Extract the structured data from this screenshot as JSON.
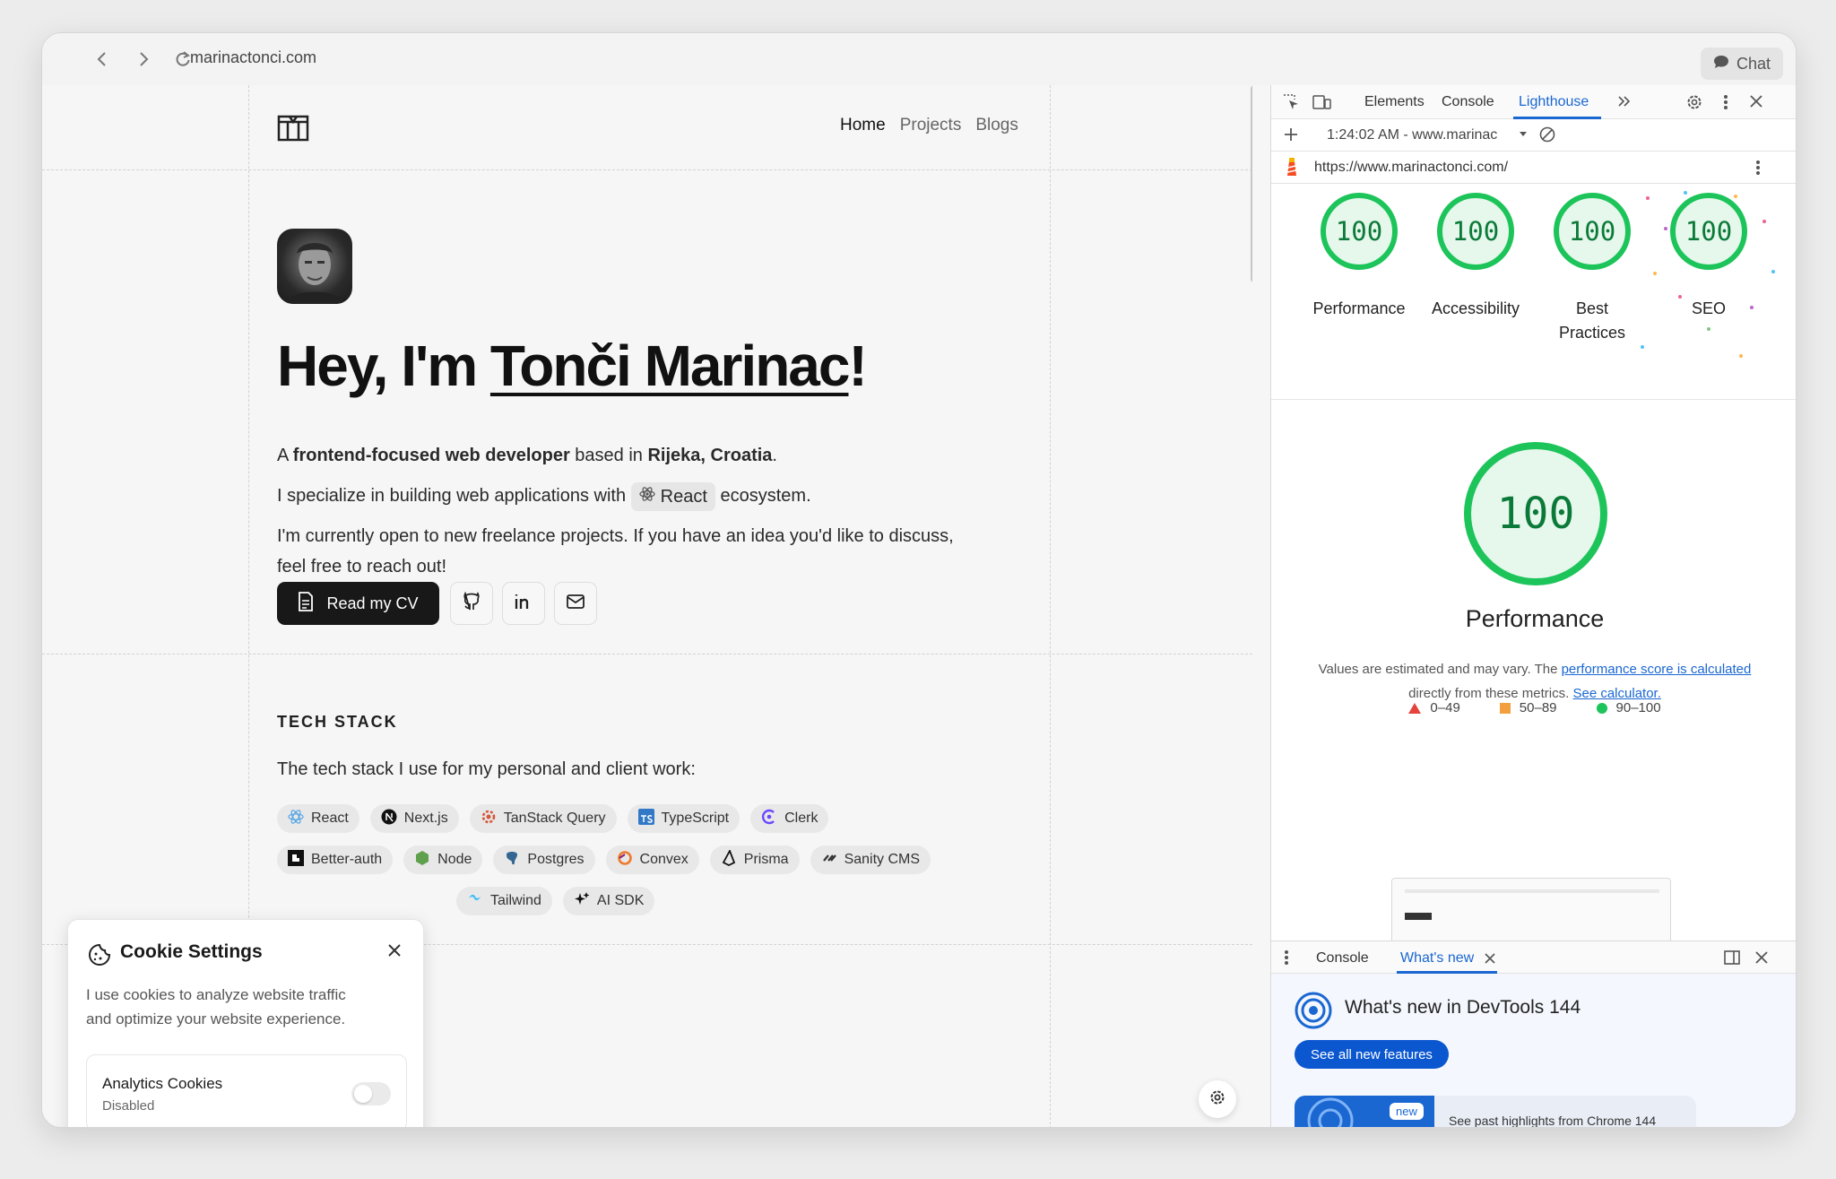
{
  "browser": {
    "url": "marinactonci.com",
    "chat_label": "Chat"
  },
  "site": {
    "nav": [
      "Home",
      "Projects",
      "Blogs"
    ],
    "hero": {
      "greeting": "Hey, I'm ",
      "name": "Tonči Marinac",
      "exclaim": "!"
    },
    "intro": {
      "a": "A ",
      "role": "frontend-focused web developer",
      "based": " based in ",
      "city": "Rijeka, Croatia",
      "dot": "."
    },
    "special": {
      "before": "I specialize in building web applications with ",
      "chip": "React",
      "after": " ecosystem."
    },
    "freelance_1": "I'm currently open to new freelance projects. If you have an idea you'd like to discuss,",
    "freelance_2": "feel free to reach out!",
    "cv_label": "Read my CV",
    "tech_title": "TECH STACK",
    "tech_intro": "The tech stack I use for my personal and client work:",
    "tech_row1": [
      "React",
      "Next.js",
      "TanStack Query",
      "TypeScript",
      "Clerk"
    ],
    "tech_row2": [
      "Better-auth",
      "Node",
      "Postgres",
      "Convex",
      "Prisma",
      "Sanity CMS"
    ],
    "tech_row3": [
      "Tailwind",
      "AI SDK"
    ]
  },
  "cookie": {
    "title": "Cookie Settings",
    "text_1": "I use cookies to analyze website traffic",
    "text_2": "and optimize your website experience.",
    "analytics_label": "Analytics Cookies",
    "analytics_state": "Disabled"
  },
  "devtools": {
    "tabs": [
      "Elements",
      "Console",
      "Lighthouse"
    ],
    "report": "1:24:02 AM - www.marinac",
    "report_url": "https://www.marinactonci.com/",
    "scores": [
      {
        "value": "100",
        "label": "Performance"
      },
      {
        "value": "100",
        "label": "Accessibility"
      },
      {
        "value": "100",
        "label": "Best Practices"
      },
      {
        "value": "100",
        "label": "SEO"
      }
    ],
    "main_score": "100",
    "main_title": "Performance",
    "note_pre": "Values are estimated and may vary. The ",
    "note_link1": "performance score is calculated",
    "note_mid": " directly from these metrics. ",
    "note_link2": "See calculator.",
    "legend": [
      "0–49",
      "50–89",
      "90–100"
    ],
    "drawer_tabs": [
      "Console",
      "What's new"
    ],
    "whatsnew_title": "What's new in DevTools 144",
    "see_all": "See all new features",
    "new_badge": "new",
    "past_highlights": "See past highlights from Chrome 144"
  },
  "colors": {
    "score_green": "#1cc45a",
    "devtools_blue": "#1a67d2",
    "fail_red": "#e4423a",
    "average_orange": "#f2a03d"
  }
}
